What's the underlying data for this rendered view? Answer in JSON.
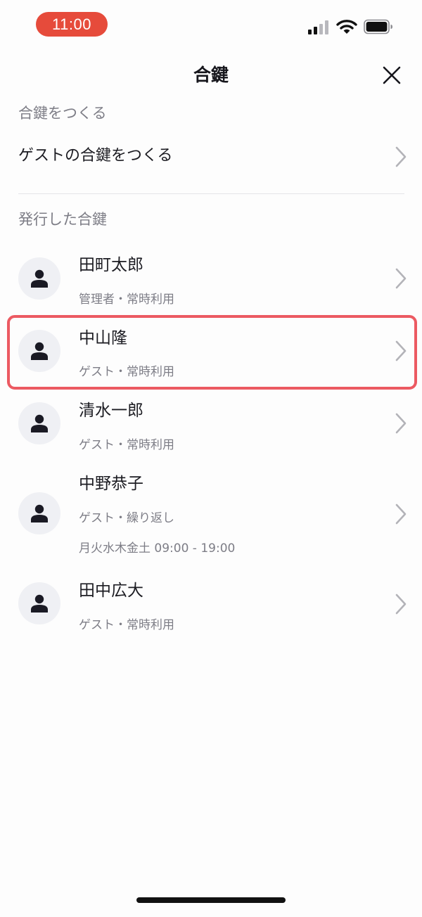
{
  "status_bar": {
    "time": "11:00",
    "time_pill_color": "#e64b3b",
    "icons": [
      "signal-icon",
      "wifi-icon",
      "battery-icon"
    ]
  },
  "header": {
    "title": "合鍵",
    "close_icon": "close-icon"
  },
  "create_section": {
    "label": "合鍵をつくる",
    "row_label": "ゲストの合鍵をつくる"
  },
  "issued_section": {
    "label": "発行した合鍵",
    "keys": [
      {
        "name": "田町太郎",
        "type": "管理者・常時利用",
        "schedule": ""
      },
      {
        "name": "中山隆",
        "type": "ゲスト・常時利用",
        "schedule": "",
        "highlighted": true
      },
      {
        "name": "清水一郎",
        "type": "ゲスト・常時利用",
        "schedule": ""
      },
      {
        "name": "中野恭子",
        "type": "ゲスト・繰り返し",
        "schedule": "月火水木金土 09:00 - 19:00"
      },
      {
        "name": "田中広大",
        "type": "ゲスト・常時利用",
        "schedule": ""
      }
    ]
  },
  "colors": {
    "highlight_border": "#ec5a62",
    "secondary_text": "#7d7d86",
    "avatar_bg": "#eff0f4"
  }
}
